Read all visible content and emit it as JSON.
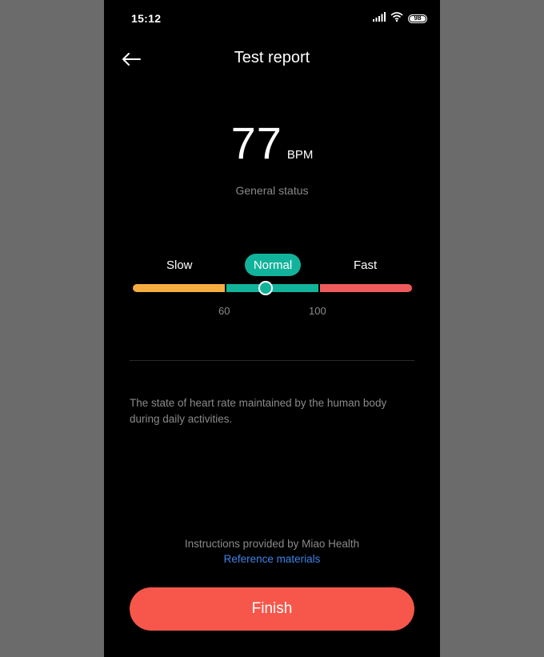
{
  "statusbar": {
    "time": "15:12",
    "battery": "98",
    "icons": [
      "signal-icon",
      "wifi-icon",
      "battery-icon"
    ]
  },
  "header": {
    "title": "Test report"
  },
  "reading": {
    "value": "77",
    "unit": "BPM",
    "status_caption": "General status"
  },
  "scale": {
    "slow_label": "Slow",
    "normal_label": "Normal",
    "fast_label": "Fast",
    "tick_low": "60",
    "tick_high": "100",
    "current_value": 77,
    "range_min": 20,
    "range_max": 140,
    "colors": {
      "slow": "#f6ad40",
      "normal": "#12b39b",
      "fast": "#ef5b5b"
    }
  },
  "description": "The state of heart rate maintained by the human body during daily activities.",
  "footer": {
    "provider": "Instructions provided by Miao Health",
    "reference_link": "Reference materials",
    "finish_label": "Finish"
  },
  "colors": {
    "accent": "#12b39b",
    "finish": "#f6574a",
    "link": "#3e83e6"
  }
}
